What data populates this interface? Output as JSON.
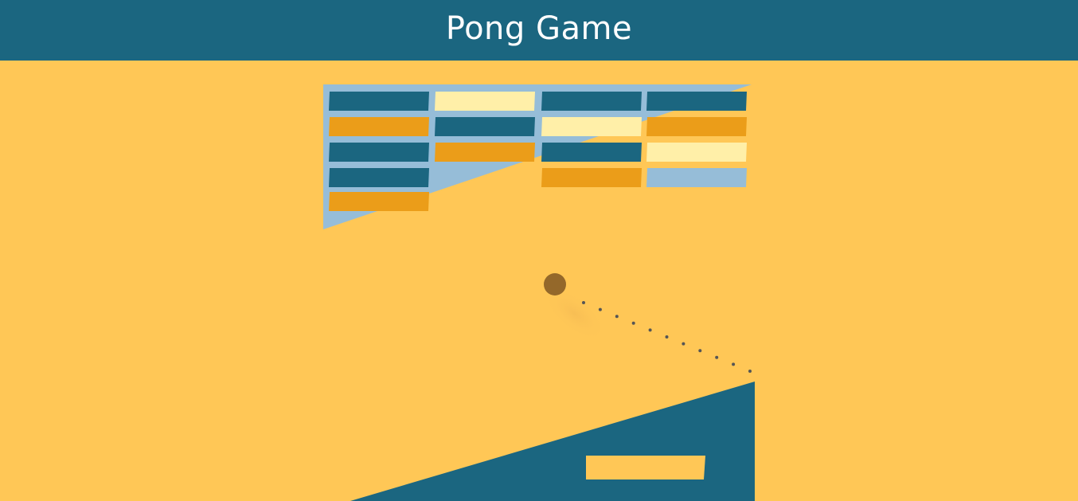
{
  "header": {
    "title": "Pong Game"
  },
  "colors": {
    "header_bg": "#1B6680",
    "background": "#FFC756",
    "panel_light_blue": "#96BDD8",
    "brick_dark": "#1B6680",
    "brick_orange": "#EB9D19",
    "brick_cream": "#FFEFA8",
    "brick_blue": "#96BDD8",
    "ball": "#94682A",
    "trajectory": "#555555",
    "paddle": "#FFC756",
    "floor": "#1B6680"
  },
  "bricks": {
    "rows": [
      [
        "dark",
        "cream",
        "dark",
        "dark"
      ],
      [
        "orange",
        "dark",
        "cream",
        "orange"
      ],
      [
        "dark",
        "orange",
        "dark",
        "cream"
      ],
      [
        "dark",
        "",
        "orange",
        "blue"
      ],
      [
        "orange",
        "",
        "",
        ""
      ]
    ]
  },
  "game": {
    "ball": "ball",
    "paddle": "paddle",
    "trajectory": "predicted-path"
  }
}
